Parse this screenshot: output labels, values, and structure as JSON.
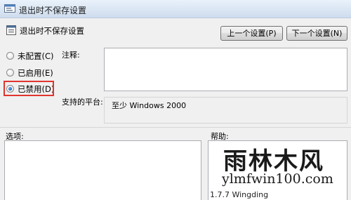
{
  "window": {
    "title": "退出时不保存设置",
    "icon": "group-policy-icon"
  },
  "header": {
    "setting_name": "退出时不保存设置",
    "icon": "policy-document-icon",
    "prev_button": "上一个设置(P)",
    "next_button": "下一个设置(N)"
  },
  "state": {
    "options": [
      {
        "label": "未配置(C)",
        "checked": false
      },
      {
        "label": "已启用(E)",
        "checked": false
      },
      {
        "label": "已禁用(D)",
        "checked": true
      }
    ],
    "highlight_color": "#e0342f"
  },
  "comment": {
    "label": "注释:",
    "value": ""
  },
  "platform": {
    "label": "支持的平台:",
    "value": "至少 Windows 2000"
  },
  "options_section": {
    "label": "选项:"
  },
  "help_section": {
    "label": "帮助:",
    "partial_text": "1.7.7 Wingding"
  },
  "watermark": {
    "logo_text": "雨林木风",
    "url": "ylmfwin100.com"
  }
}
